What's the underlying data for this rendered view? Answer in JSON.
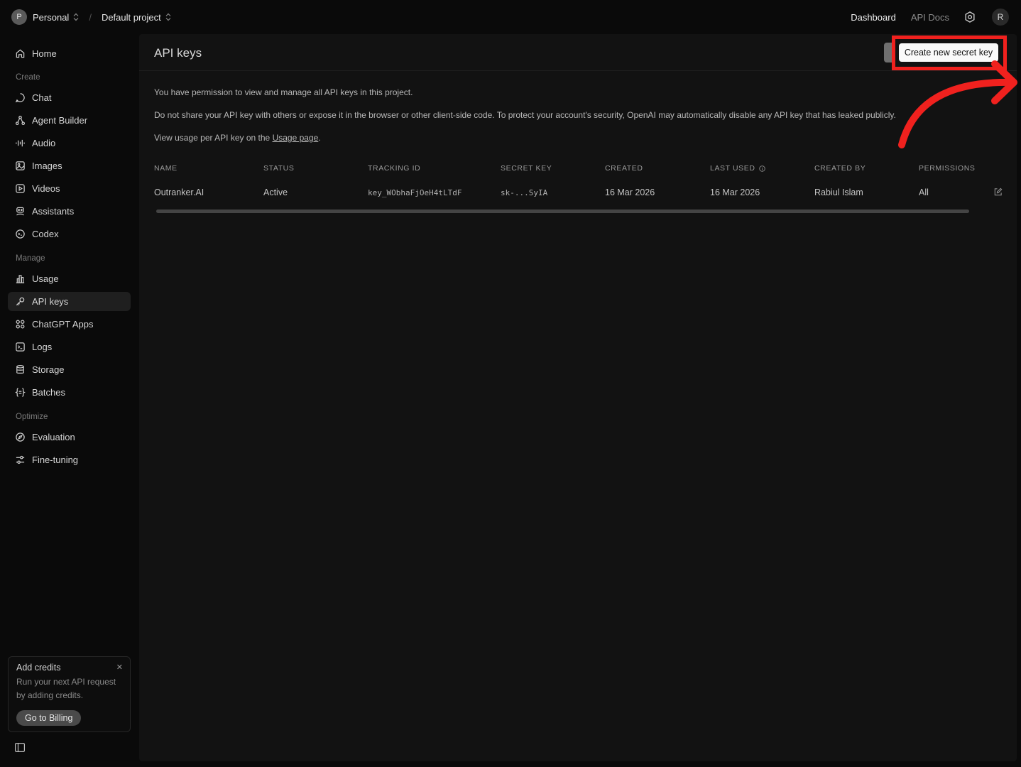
{
  "topbar": {
    "org_initial": "P",
    "org_name": "Personal",
    "project_name": "Default project",
    "nav_dashboard": "Dashboard",
    "nav_api_docs": "API Docs",
    "user_initial": "R"
  },
  "sidebar": {
    "home": "Home",
    "section_create": "Create",
    "create_items": [
      "Chat",
      "Agent Builder",
      "Audio",
      "Images",
      "Videos",
      "Assistants",
      "Codex"
    ],
    "section_manage": "Manage",
    "manage_items": [
      "Usage",
      "API keys",
      "ChatGPT Apps",
      "Logs",
      "Storage",
      "Batches"
    ],
    "section_optimize": "Optimize",
    "optimize_items": [
      "Evaluation",
      "Fine-tuning"
    ],
    "credits": {
      "title": "Add credits",
      "text": "Run your next API request by adding credits.",
      "button": "Go to Billing"
    }
  },
  "main": {
    "title": "API keys",
    "create_button": "Create new secret key",
    "info_1": "You have permission to view and manage all API keys in this project.",
    "info_2": "Do not share your API key with others or expose it in the browser or other client-side code. To protect your account's security, OpenAI may automatically disable any API key that has leaked publicly.",
    "info_3_prefix": "View usage per API key on the ",
    "info_3_link": "Usage page",
    "info_3_suffix": ".",
    "table": {
      "headers": [
        "NAME",
        "STATUS",
        "TRACKING ID",
        "SECRET KEY",
        "CREATED",
        "LAST USED",
        "CREATED BY",
        "PERMISSIONS"
      ],
      "rows": [
        [
          "Outranker.AI",
          "Active",
          "key_WObhaFjOeH4tLTdF",
          "sk-...SyIA",
          "16 Mar 2026",
          "16 Mar 2026",
          "Rabiul Islam",
          "All"
        ]
      ]
    }
  },
  "annotation": {
    "highlight_color": "#f0211e"
  }
}
